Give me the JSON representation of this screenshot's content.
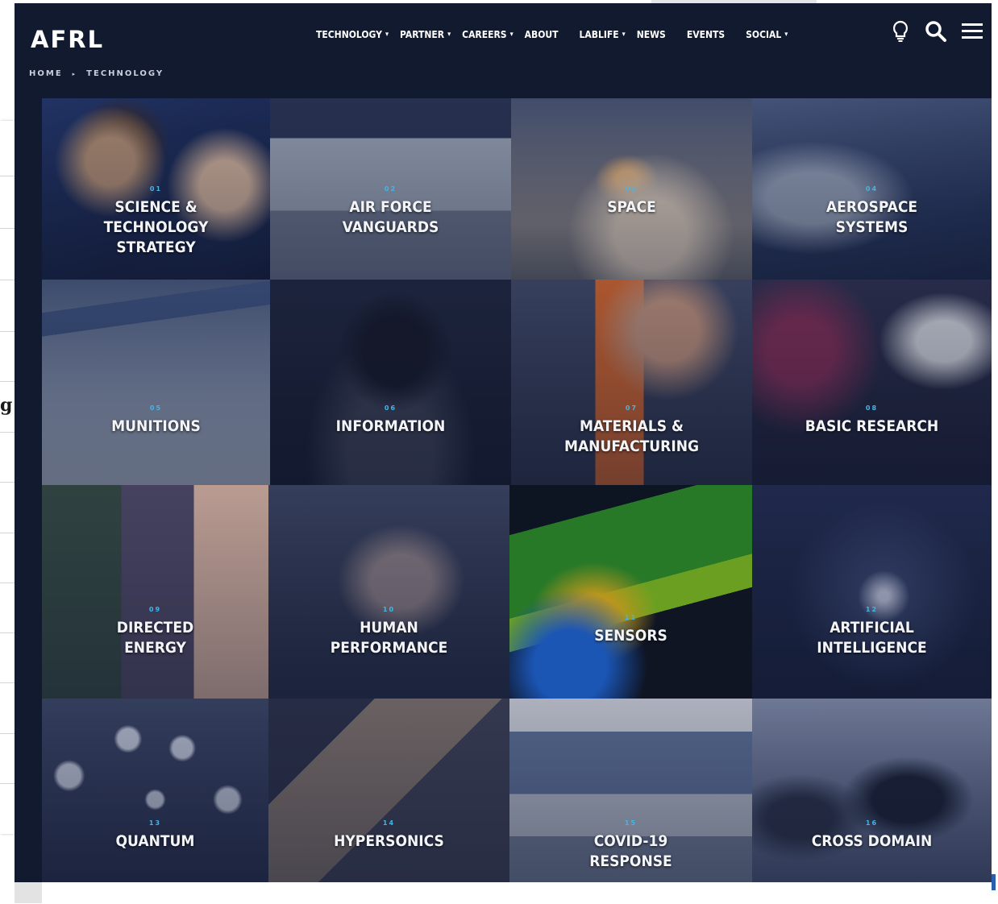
{
  "site": {
    "logo": "AFRL",
    "nav": [
      {
        "label": "TECHNOLOGY",
        "has_dropdown": true
      },
      {
        "label": "PARTNER",
        "has_dropdown": true
      },
      {
        "label": "CAREERS",
        "has_dropdown": true
      },
      {
        "label": "ABOUT",
        "has_dropdown": false
      },
      {
        "label": "LABLIFE",
        "has_dropdown": true
      },
      {
        "label": "NEWS",
        "has_dropdown": false
      },
      {
        "label": "EVENTS",
        "has_dropdown": false
      },
      {
        "label": "SOCIAL",
        "has_dropdown": true
      }
    ],
    "icons": [
      "lightbulb-icon",
      "search-icon",
      "menu-icon"
    ],
    "breadcrumb": [
      "HOME",
      "TECHNOLOGY"
    ]
  },
  "tiles": [
    {
      "num": "01",
      "title": "SCIENCE &\nTECHNOLOGY\nSTRATEGY"
    },
    {
      "num": "02",
      "title": "AIR FORCE\nVANGUARDS"
    },
    {
      "num": "03",
      "title": "SPACE"
    },
    {
      "num": "04",
      "title": "AEROSPACE\nSYSTEMS"
    },
    {
      "num": "05",
      "title": "MUNITIONS"
    },
    {
      "num": "06",
      "title": "INFORMATION"
    },
    {
      "num": "07",
      "title": "MATERIALS &\nMANUFACTURING"
    },
    {
      "num": "08",
      "title": "BASIC RESEARCH"
    },
    {
      "num": "09",
      "title": "DIRECTED\nENERGY"
    },
    {
      "num": "10",
      "title": "HUMAN\nPERFORMANCE"
    },
    {
      "num": "11",
      "title": "SENSORS"
    },
    {
      "num": "12",
      "title": "ARTIFICIAL\nINTELLIGENCE"
    },
    {
      "num": "13",
      "title": "QUANTUM"
    },
    {
      "num": "14",
      "title": "HYPERSONICS"
    },
    {
      "num": "15",
      "title": "COVID-19\nRESPONSE"
    },
    {
      "num": "16",
      "title": "CROSS DOMAIN"
    }
  ],
  "background_page": {
    "visible_glyph": "g"
  },
  "colors": {
    "header_bg": "#111a2e",
    "accent_number": "#46b4e6",
    "tile_text": "#f2f4f8"
  }
}
